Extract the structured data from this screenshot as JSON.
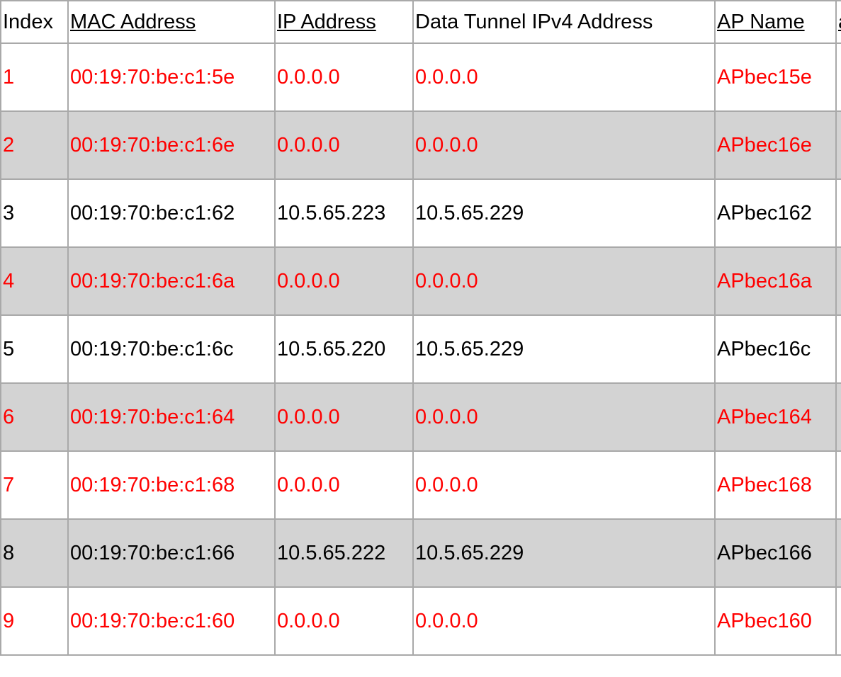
{
  "table": {
    "headers": [
      {
        "key": "index",
        "label": "Index",
        "sortable": false
      },
      {
        "key": "mac",
        "label": "MAC Address",
        "sortable": true
      },
      {
        "key": "ip",
        "label": "IP Address",
        "sortable": true
      },
      {
        "key": "tunnel",
        "label": "Data Tunnel IPv4 Address",
        "sortable": false
      },
      {
        "key": "apname",
        "label": "AP Name",
        "sortable": true
      },
      {
        "key": "extra",
        "label": "a",
        "sortable": true
      }
    ],
    "rows": [
      {
        "index": "1",
        "mac": "00:19:70:be:c1:5e",
        "ip": "0.0.0.0",
        "tunnel": "0.0.0.0",
        "apname": "APbec15e",
        "status": "down"
      },
      {
        "index": "2",
        "mac": "00:19:70:be:c1:6e",
        "ip": "0.0.0.0",
        "tunnel": "0.0.0.0",
        "apname": "APbec16e",
        "status": "down"
      },
      {
        "index": "3",
        "mac": "00:19:70:be:c1:62",
        "ip": "10.5.65.223",
        "tunnel": "10.5.65.229",
        "apname": "APbec162",
        "status": "up"
      },
      {
        "index": "4",
        "mac": "00:19:70:be:c1:6a",
        "ip": "0.0.0.0",
        "tunnel": "0.0.0.0",
        "apname": "APbec16a",
        "status": "down"
      },
      {
        "index": "5",
        "mac": "00:19:70:be:c1:6c",
        "ip": "10.5.65.220",
        "tunnel": "10.5.65.229",
        "apname": "APbec16c",
        "status": "up"
      },
      {
        "index": "6",
        "mac": "00:19:70:be:c1:64",
        "ip": "0.0.0.0",
        "tunnel": "0.0.0.0",
        "apname": "APbec164",
        "status": "down"
      },
      {
        "index": "7",
        "mac": "00:19:70:be:c1:68",
        "ip": "0.0.0.0",
        "tunnel": "0.0.0.0",
        "apname": "APbec168",
        "status": "down"
      },
      {
        "index": "8",
        "mac": "00:19:70:be:c1:66",
        "ip": "10.5.65.222",
        "tunnel": "10.5.65.229",
        "apname": "APbec166",
        "status": "up"
      },
      {
        "index": "9",
        "mac": "00:19:70:be:c1:60",
        "ip": "0.0.0.0",
        "tunnel": "0.0.0.0",
        "apname": "APbec160",
        "status": "down"
      }
    ]
  },
  "colors": {
    "row_alt_background": "#d3d3d3",
    "row_background": "#ffffff",
    "status_down_text": "#ff0000",
    "status_up_text": "#000000",
    "grid_border": "#a9a9a9"
  }
}
